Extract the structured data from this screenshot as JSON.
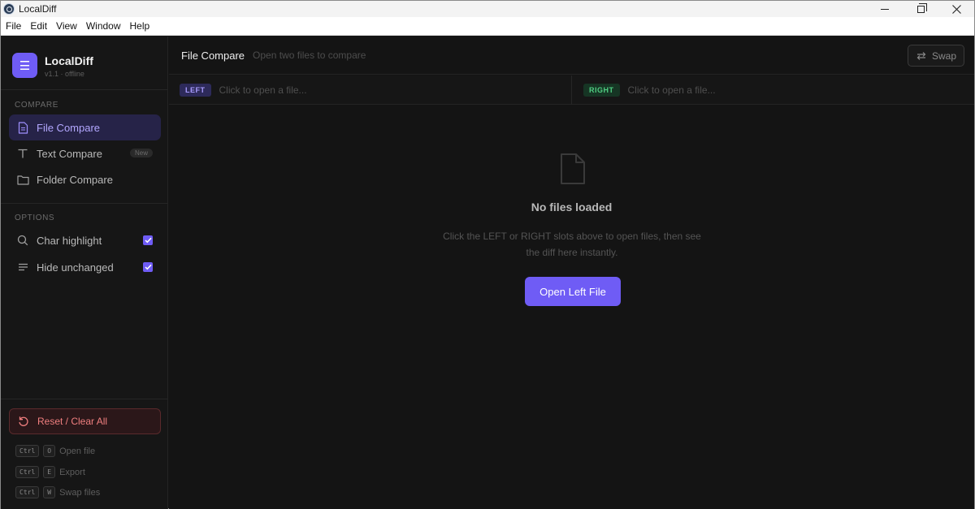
{
  "window": {
    "title": "LocalDiff",
    "controls": [
      "minimize-icon",
      "restore-icon",
      "close-icon"
    ]
  },
  "menu": [
    "File",
    "Edit",
    "View",
    "Window",
    "Help"
  ],
  "sidebar": {
    "brand": {
      "name": "LocalDiff",
      "version": "v1.1 · offline",
      "logo_glyph": "☰"
    },
    "compare_label": "COMPARE",
    "nav": [
      {
        "label": "File Compare",
        "icon": "file-icon",
        "active": true
      },
      {
        "label": "Text Compare",
        "icon": "text-icon",
        "badge": "New"
      },
      {
        "label": "Folder Compare",
        "icon": "folder-icon"
      }
    ],
    "options_label": "OPTIONS",
    "options": [
      {
        "label": "Char highlight",
        "icon": "search-icon",
        "checked": true
      },
      {
        "label": "Hide unchanged",
        "icon": "lines-icon",
        "checked": true
      }
    ],
    "reset_label": "Reset / Clear All",
    "shortcuts": [
      {
        "mod": "Ctrl",
        "key": "O",
        "label": "Open file"
      },
      {
        "mod": "Ctrl",
        "key": "E",
        "label": "Export"
      },
      {
        "mod": "Ctrl",
        "key": "W",
        "label": "Swap files"
      }
    ]
  },
  "header": {
    "title": "File Compare",
    "subtitle": "Open two files to compare",
    "swap_label": "Swap"
  },
  "slots": {
    "left": {
      "tag": "LEFT",
      "placeholder": "Click to open a file..."
    },
    "right": {
      "tag": "RIGHT",
      "placeholder": "Click to open a file..."
    }
  },
  "empty": {
    "title": "No files loaded",
    "description": "Click the LEFT or RIGHT slots above to open files, then see the diff here instantly.",
    "button": "Open Left File"
  },
  "colors": {
    "accent": "#6f5cf5",
    "background": "#141414",
    "sidebar": "#161616",
    "danger": "#f07f7f",
    "success": "#4fce82"
  }
}
